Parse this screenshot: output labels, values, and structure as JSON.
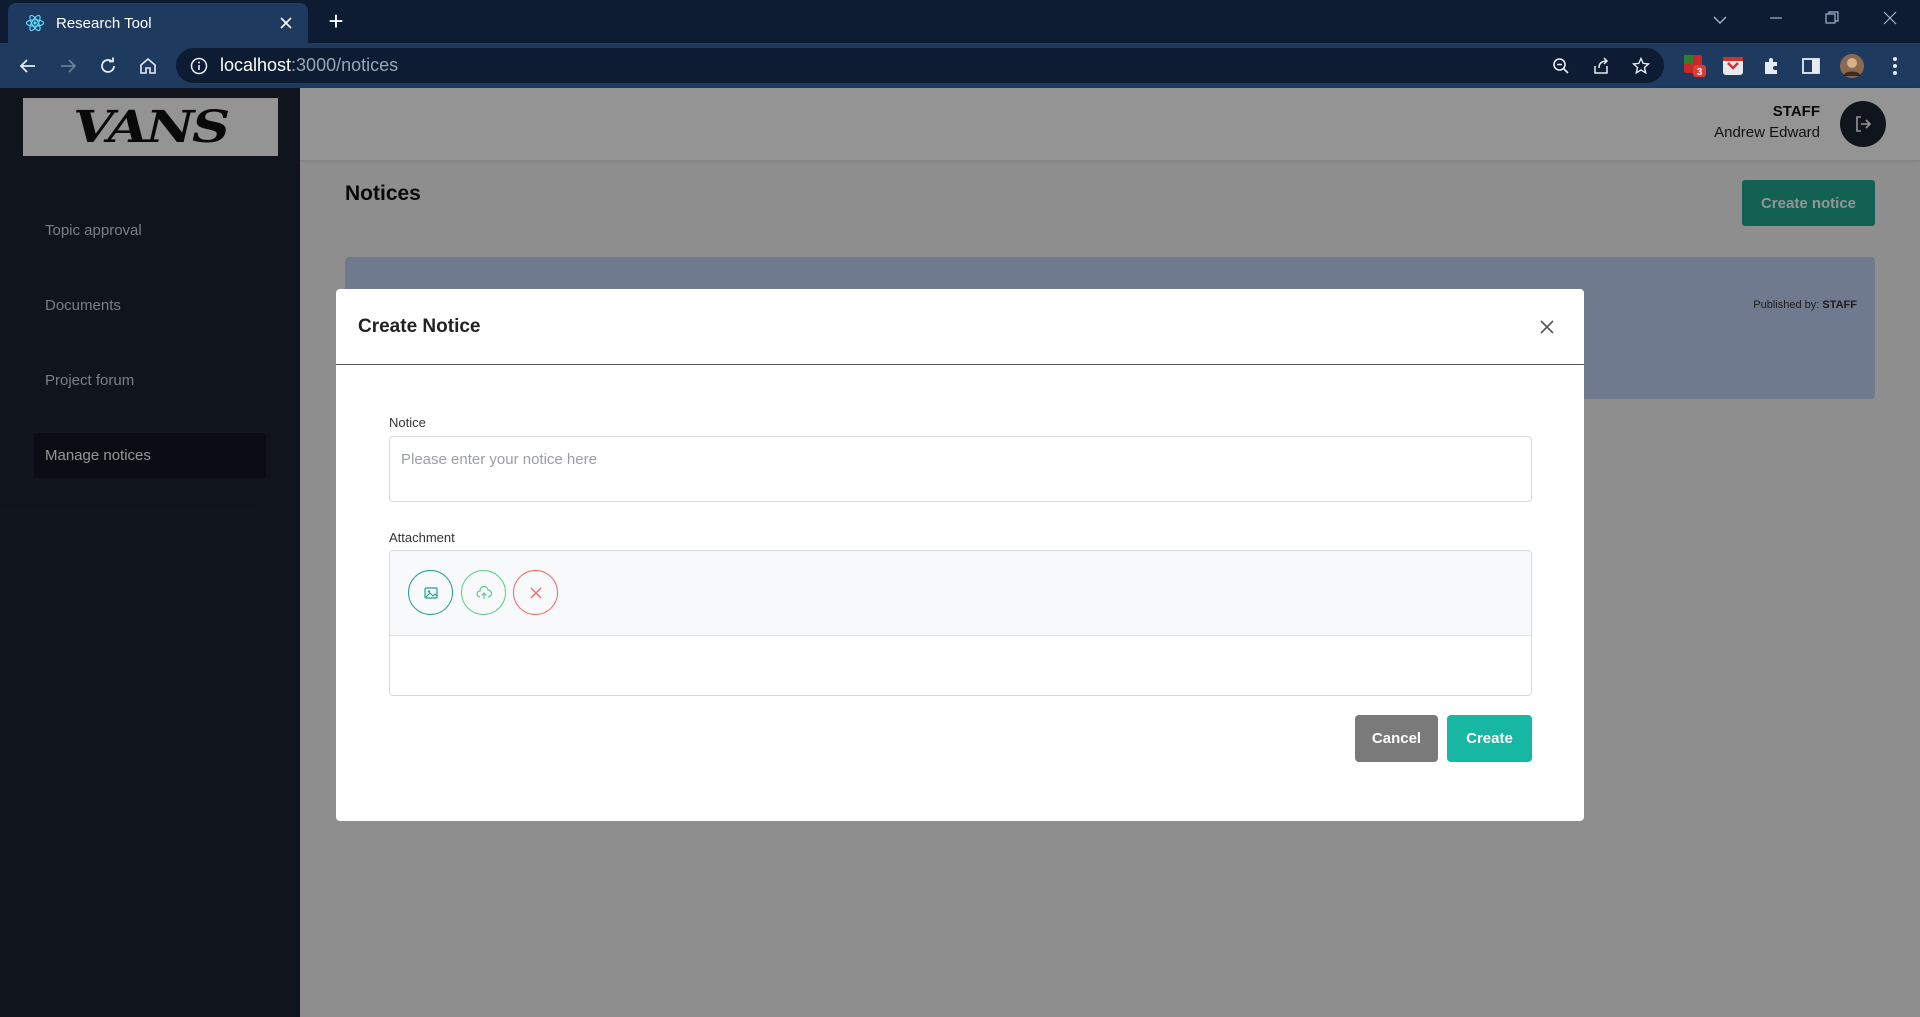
{
  "browser": {
    "tab_title": "Research Tool",
    "url_host": "localhost",
    "url_path": ":3000/notices",
    "extension_badge": "3"
  },
  "sidebar": {
    "logo": "VANS",
    "items": [
      {
        "label": "Topic approval"
      },
      {
        "label": "Documents"
      },
      {
        "label": "Project forum"
      },
      {
        "label": "Manage notices",
        "active": true
      }
    ]
  },
  "header": {
    "role": "STAFF",
    "user_name": "Andrew Edward"
  },
  "main": {
    "page_title": "Notices",
    "create_button": "Create notice",
    "card": {
      "published_prefix": "Published by: ",
      "published_by": "STAFF"
    }
  },
  "modal": {
    "title": "Create Notice",
    "notice_label": "Notice",
    "notice_placeholder": "Please enter your notice here",
    "notice_value": "",
    "attachment_label": "Attachment",
    "cancel_button": "Cancel",
    "create_button": "Create"
  },
  "colors": {
    "accent": "#17b7a4",
    "sidebar_bg": "#1c2533",
    "card_bg": "#c0d3f4"
  },
  "icons": {
    "choose": "image-icon",
    "upload": "cloud-upload-icon",
    "cancel": "close-icon"
  }
}
